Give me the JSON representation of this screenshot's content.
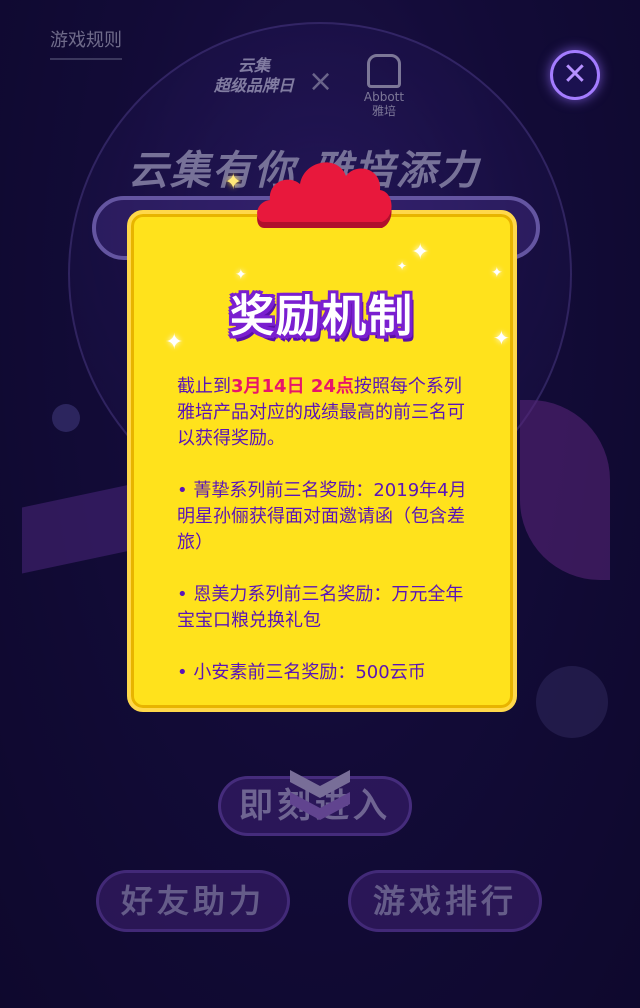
{
  "header": {
    "rules_link": "游戏规则",
    "logo_left_line1": "云集",
    "logo_left_line2": "超级品牌日",
    "logo_separator": "×",
    "logo_right_name": "Abbott",
    "logo_right_cn": "雅培",
    "close_icon_glyph": "✕"
  },
  "background": {
    "slogan": "云集有你 雅培添力"
  },
  "modal": {
    "title": "奖励机制",
    "intro_prefix": "截止到",
    "intro_date": "3月14日 24点",
    "intro_suffix": "按照每个系列雅培产品对应的成绩最高的前三名可以获得奖励。",
    "rewards": [
      "•  菁挚系列前三名奖励：2019年4月明星孙俪获得面对面邀请函（包含差旅）",
      "•   恩美力系列前三名奖励：万元全年宝宝口粮兑换礼包",
      "• 小安素前三名奖励：500云币"
    ]
  },
  "buttons": {
    "enter": "即刻进入",
    "friend_help": "好友助力",
    "game_rank": "游戏排行"
  },
  "colors": {
    "modal_bg": "#ffe21c",
    "modal_text": "#5a14b8",
    "highlight": "#e8146b",
    "cloud": "#e8183c",
    "title_stroke": "#7a1fd0"
  }
}
